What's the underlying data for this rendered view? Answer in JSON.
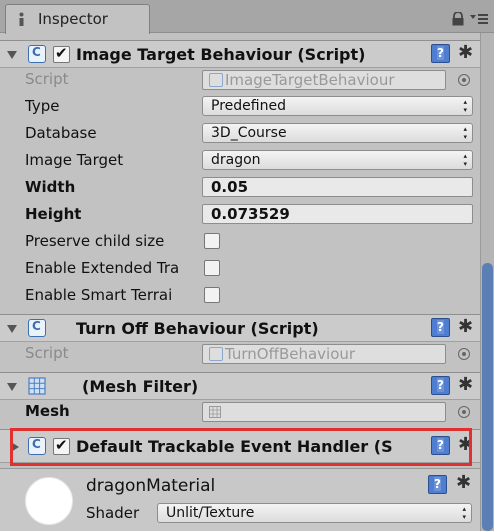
{
  "tab": {
    "title": "Inspector",
    "icon": "info-icon"
  },
  "image_target_behaviour": {
    "title": "Image Target Behaviour (Script)",
    "enabled": true,
    "properties": {
      "script": {
        "label": "Script",
        "value": "ImageTargetBehaviour"
      },
      "type": {
        "label": "Type",
        "value": "Predefined"
      },
      "database": {
        "label": "Database",
        "value": "3D_Course"
      },
      "image_target": {
        "label": "Image Target",
        "value": "dragon"
      },
      "width": {
        "label": "Width",
        "value": "0.05"
      },
      "height": {
        "label": "Height",
        "value": "0.073529"
      },
      "preserve_child_size": {
        "label": "Preserve child size",
        "checked": false
      },
      "enable_extended_tracking": {
        "label": "Enable Extended Tra",
        "checked": false
      },
      "enable_smart_terrain": {
        "label": "Enable Smart Terrai",
        "checked": false
      }
    }
  },
  "turn_off_behaviour": {
    "title": "Turn Off Behaviour (Script)",
    "script": {
      "label": "Script",
      "value": "TurnOffBehaviour"
    }
  },
  "mesh_filter": {
    "title": "(Mesh Filter)",
    "mesh": {
      "label": "Mesh",
      "value": ""
    }
  },
  "default_trackable_event_handler": {
    "title": "Default Trackable Event Handler (S",
    "enabled": true,
    "expanded": false,
    "highlight_color": "#e03131"
  },
  "material": {
    "name": "dragonMaterial",
    "shader_label": "Shader",
    "shader_value": "Unlit/Texture"
  },
  "colors": {
    "header_bg": "#cbcbcb",
    "panel_bg": "#c2c2c2",
    "scroll_thumb": "#5b7fb4",
    "help_icon": "#4f7ed1"
  }
}
